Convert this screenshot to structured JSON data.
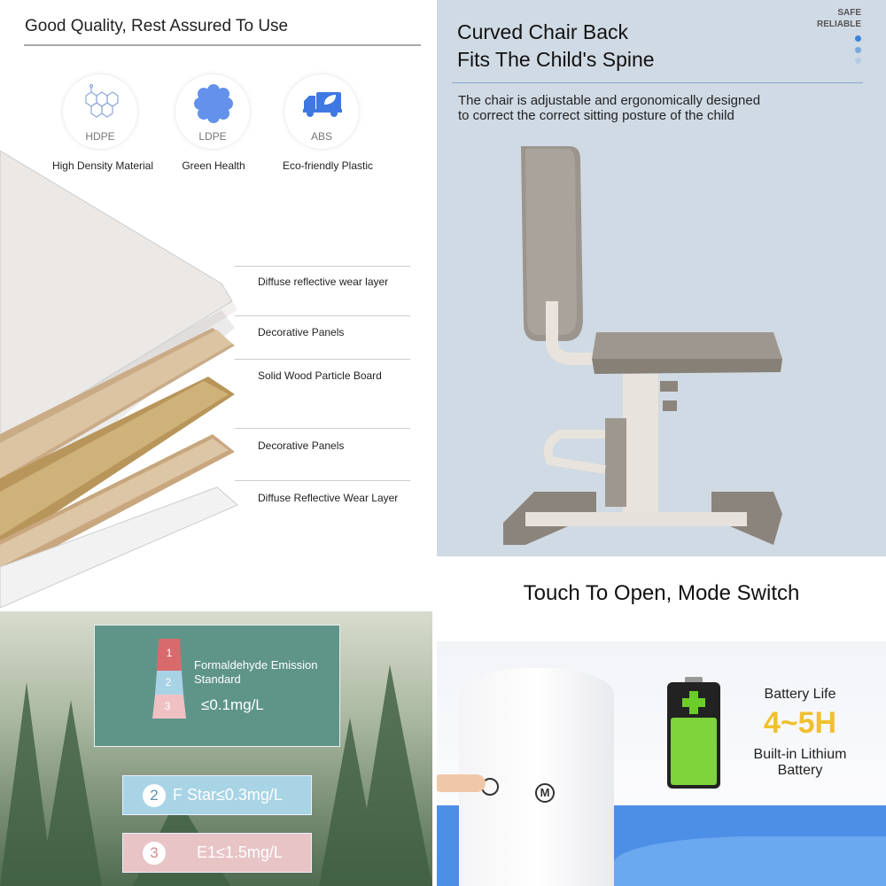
{
  "materials_panel": {
    "title": "Good Quality, Rest Assured To Use",
    "materials": [
      {
        "code": "HDPE",
        "label": "High Density Material",
        "icon": "hexagon-molecule-icon"
      },
      {
        "code": "LDPE",
        "label": "Green Health",
        "icon": "blue-flower-icon"
      },
      {
        "code": "ABS",
        "label": "Eco-friendly Plastic",
        "icon": "eco-truck-icon"
      }
    ],
    "layers": [
      "Diffuse reflective wear layer",
      "Decorative Panels",
      "Solid Wood Particle Board",
      "Decorative Panels",
      "Diffuse Reflective Wear Layer"
    ],
    "accent": "#4a7fe8"
  },
  "chair_panel": {
    "title_line1": "Curved Chair Back",
    "title_line2": "Fits The Child's Spine",
    "badge_line1": "SAFE",
    "badge_line2": "RELIABLE",
    "description_line1": "The chair is adjustable and ergonomically designed",
    "description_line2": "to correct the correct sitting posture of the child",
    "background": "#d0dae4"
  },
  "emission_panel": {
    "pyramid_levels": [
      "1",
      "2",
      "3"
    ],
    "standard_label_line1": "Formaldehyde Emission",
    "standard_label_line2": "Standard",
    "standard_value": "≤0.1mg/L",
    "bands": [
      {
        "num": "2",
        "text": "F Star≤0.3mg/L",
        "color": "#a8d4e6"
      },
      {
        "num": "3",
        "text": "E1≤1.5mg/L",
        "color": "#e8c4c6"
      }
    ]
  },
  "lamp_panel": {
    "title": "Touch To Open, Mode Switch",
    "battery_label": "Battery Life",
    "battery_hours": "4~5H",
    "battery_type_line1": "Built-in Lithium",
    "battery_type_line2": "Battery",
    "mode_button": "M",
    "hours_color": "#f0c030"
  }
}
